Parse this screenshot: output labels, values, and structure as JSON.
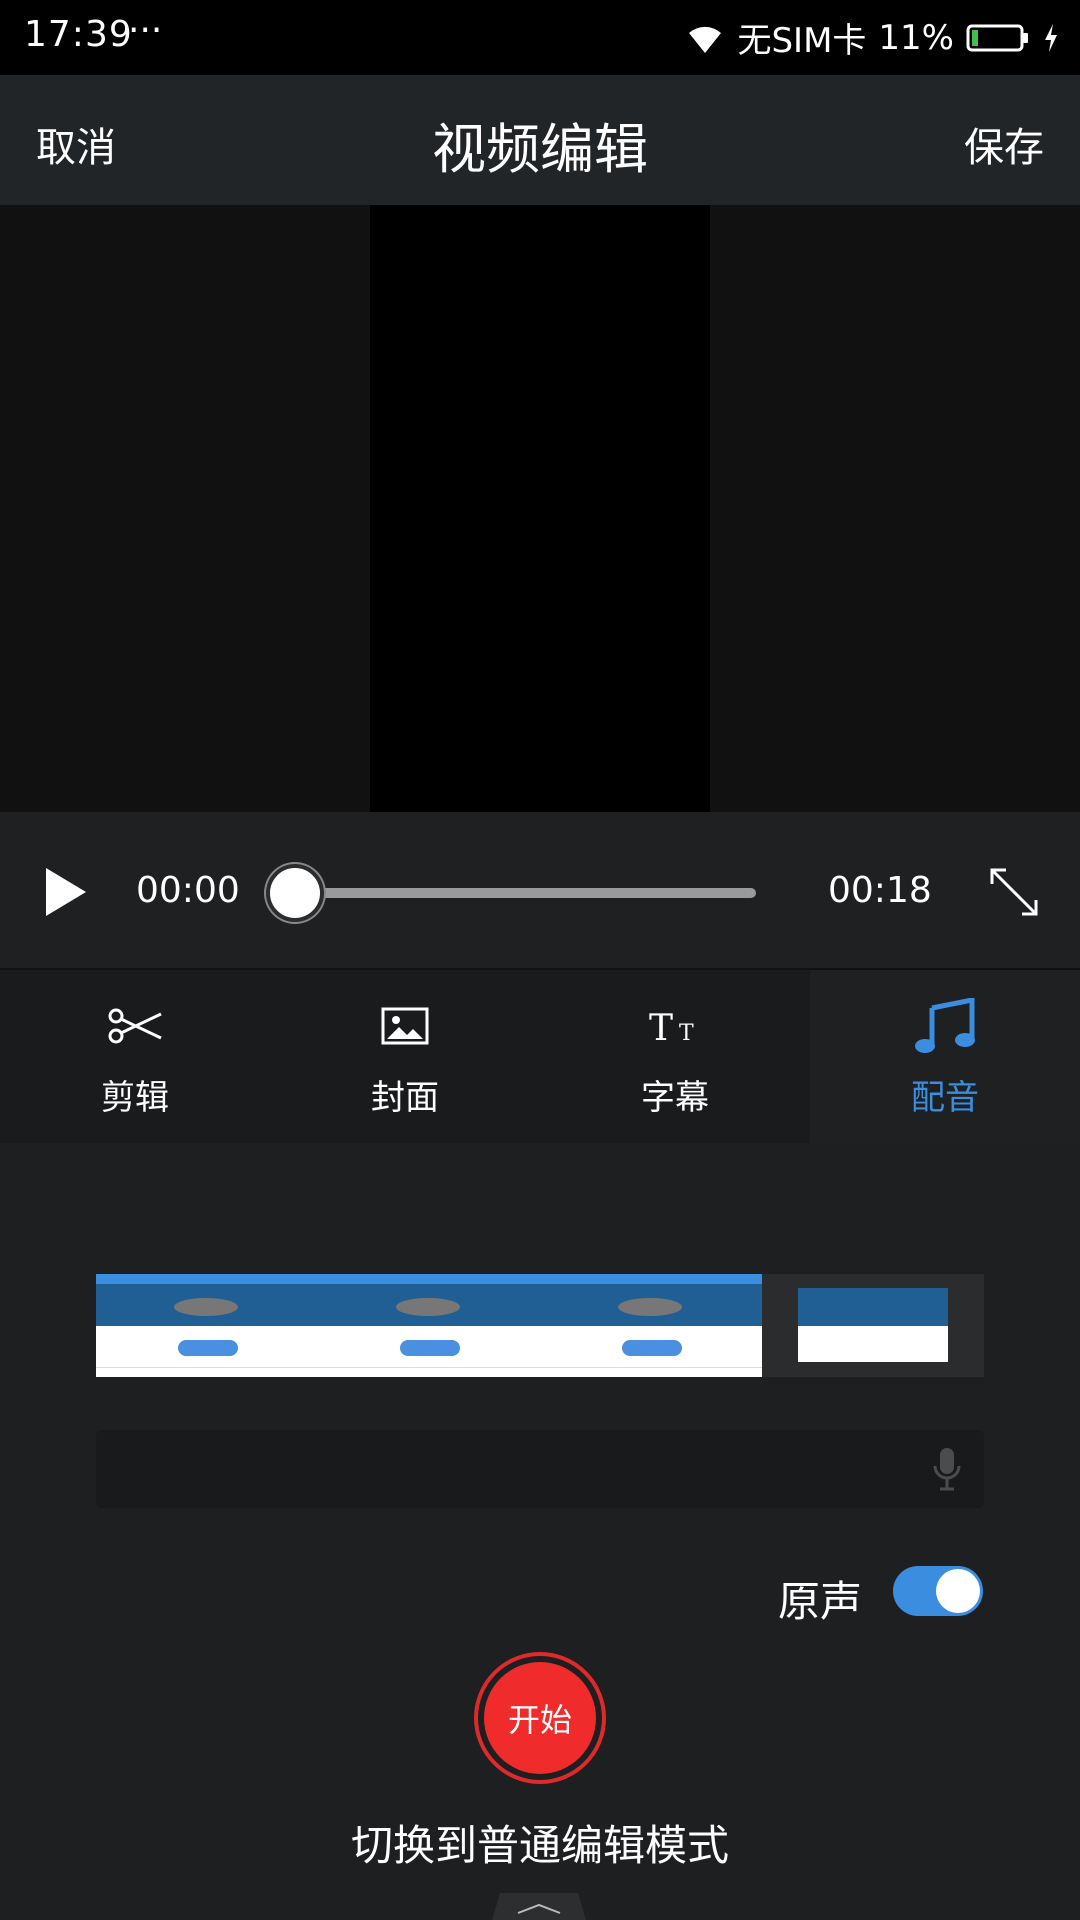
{
  "status_bar": {
    "time": "17:39",
    "dots": "···",
    "carrier": "无SIM卡",
    "battery": "11%",
    "icons": [
      "wifi-icon",
      "battery-icon",
      "charging-icon"
    ]
  },
  "header": {
    "cancel": "取消",
    "title": "视频编辑",
    "save": "保存"
  },
  "player": {
    "current_time": "00:00",
    "total_time": "00:18",
    "progress": 0
  },
  "tools": [
    {
      "label": "剪辑",
      "icon": "scissors-icon"
    },
    {
      "label": "封面",
      "icon": "image-icon"
    },
    {
      "label": "字幕",
      "icon": "text-size-icon"
    },
    {
      "label": "配音",
      "icon": "music-note-icon",
      "active": true
    }
  ],
  "dubbing": {
    "original_sound_label": "原声",
    "original_sound_on": true,
    "record_label": "开始",
    "switch_mode": "切换到普通编辑模式"
  },
  "colors": {
    "accent": "#3b8de0",
    "record": "#f02b2b",
    "background": "#1d1f21"
  }
}
